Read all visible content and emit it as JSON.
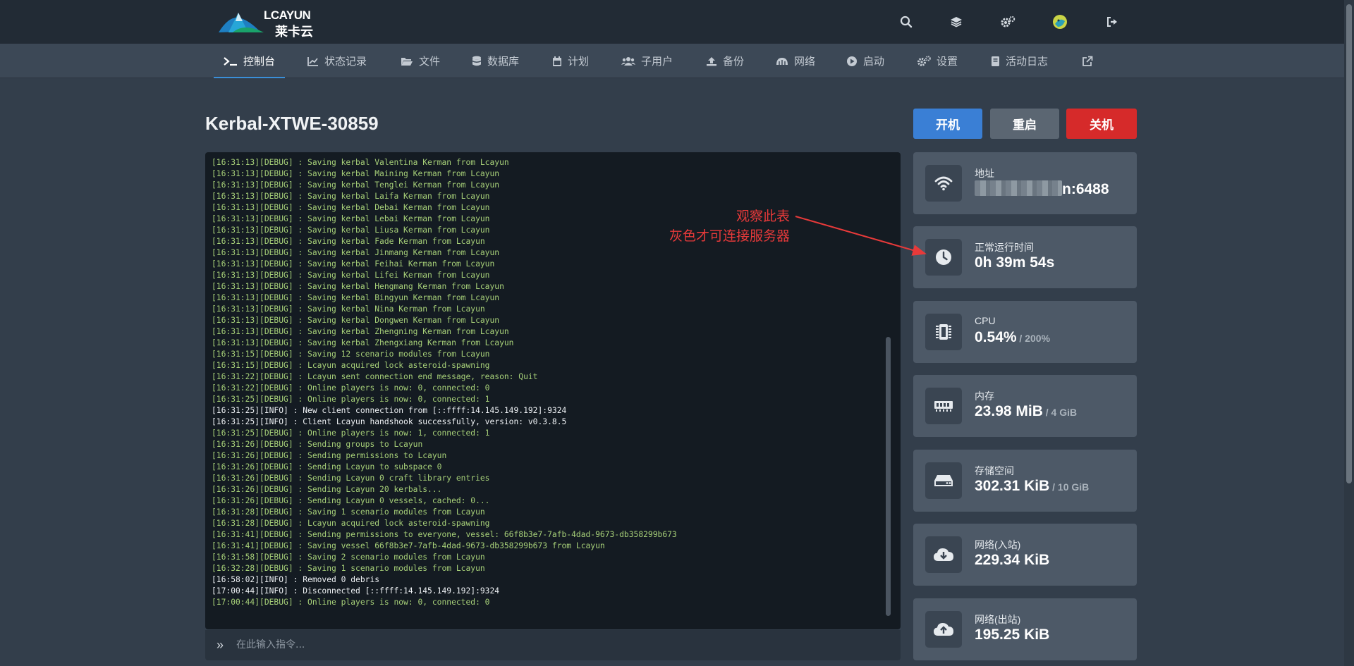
{
  "brand": {
    "logo_text": "LCAYUN",
    "logo_sub": "莱卡云"
  },
  "header_icons": [
    "search-icon",
    "layers-icon",
    "gears-icon",
    "avatar",
    "logout-icon"
  ],
  "nav": {
    "items": [
      {
        "label": "控制台",
        "icon": "terminal-icon",
        "active": true
      },
      {
        "label": "状态记录",
        "icon": "chart-icon"
      },
      {
        "label": "文件",
        "icon": "folder-icon"
      },
      {
        "label": "数据库",
        "icon": "database-icon"
      },
      {
        "label": "计划",
        "icon": "calendar-icon"
      },
      {
        "label": "子用户",
        "icon": "users-icon"
      },
      {
        "label": "备份",
        "icon": "upload-icon"
      },
      {
        "label": "网络",
        "icon": "network-icon"
      },
      {
        "label": "启动",
        "icon": "play-icon"
      },
      {
        "label": "设置",
        "icon": "settings-icon"
      },
      {
        "label": "活动日志",
        "icon": "book-icon"
      }
    ],
    "external_icon": "external-link-icon"
  },
  "server": {
    "title": "Kerbal-XTWE-30859"
  },
  "power": {
    "start": "开机",
    "restart": "重启",
    "stop": "关机"
  },
  "console": {
    "placeholder": "在此输入指令...",
    "prompt": "»",
    "lines": [
      {
        "level": "debug",
        "text": "[16:31:13][DEBUG] : Saving kerbal Valentina Kerman from Lcayun"
      },
      {
        "level": "debug",
        "text": "[16:31:13][DEBUG] : Saving kerbal Maining Kerman from Lcayun"
      },
      {
        "level": "debug",
        "text": "[16:31:13][DEBUG] : Saving kerbal Tenglei Kerman from Lcayun"
      },
      {
        "level": "debug",
        "text": "[16:31:13][DEBUG] : Saving kerbal Laifa Kerman from Lcayun"
      },
      {
        "level": "debug",
        "text": "[16:31:13][DEBUG] : Saving kerbal Debai Kerman from Lcayun"
      },
      {
        "level": "debug",
        "text": "[16:31:13][DEBUG] : Saving kerbal Lebai Kerman from Lcayun"
      },
      {
        "level": "debug",
        "text": "[16:31:13][DEBUG] : Saving kerbal Liusa Kerman from Lcayun"
      },
      {
        "level": "debug",
        "text": "[16:31:13][DEBUG] : Saving kerbal Fade Kerman from Lcayun"
      },
      {
        "level": "debug",
        "text": "[16:31:13][DEBUG] : Saving kerbal Jinmang Kerman from Lcayun"
      },
      {
        "level": "debug",
        "text": "[16:31:13][DEBUG] : Saving kerbal Feihai Kerman from Lcayun"
      },
      {
        "level": "debug",
        "text": "[16:31:13][DEBUG] : Saving kerbal Lifei Kerman from Lcayun"
      },
      {
        "level": "debug",
        "text": "[16:31:13][DEBUG] : Saving kerbal Hengmang Kerman from Lcayun"
      },
      {
        "level": "debug",
        "text": "[16:31:13][DEBUG] : Saving kerbal Bingyun Kerman from Lcayun"
      },
      {
        "level": "debug",
        "text": "[16:31:13][DEBUG] : Saving kerbal Nina Kerman from Lcayun"
      },
      {
        "level": "debug",
        "text": "[16:31:13][DEBUG] : Saving kerbal Dongwen Kerman from Lcayun"
      },
      {
        "level": "debug",
        "text": "[16:31:13][DEBUG] : Saving kerbal Zhengning Kerman from Lcayun"
      },
      {
        "level": "debug",
        "text": "[16:31:13][DEBUG] : Saving kerbal Zhengxiang Kerman from Lcayun"
      },
      {
        "level": "debug",
        "text": "[16:31:15][DEBUG] : Saving 12 scenario modules from Lcayun"
      },
      {
        "level": "debug",
        "text": "[16:31:15][DEBUG] : Lcayun acquired lock asteroid-spawning"
      },
      {
        "level": "debug",
        "text": "[16:31:22][DEBUG] : Lcayun sent connection end message, reason: Quit"
      },
      {
        "level": "debug",
        "text": "[16:31:22][DEBUG] : Online players is now: 0, connected: 0"
      },
      {
        "level": "debug",
        "text": "[16:31:25][DEBUG] : Online players is now: 0, connected: 1"
      },
      {
        "level": "info",
        "text": "[16:31:25][INFO] : New client connection from [::ffff:14.145.149.192]:9324"
      },
      {
        "level": "info",
        "text": "[16:31:25][INFO] : Client Lcayun handshook successfully, version: v0.3.8.5"
      },
      {
        "level": "debug",
        "text": "[16:31:25][DEBUG] : Online players is now: 1, connected: 1"
      },
      {
        "level": "debug",
        "text": "[16:31:26][DEBUG] : Sending groups to Lcayun"
      },
      {
        "level": "debug",
        "text": "[16:31:26][DEBUG] : Sending permissions to Lcayun"
      },
      {
        "level": "debug",
        "text": "[16:31:26][DEBUG] : Sending Lcayun to subspace 0"
      },
      {
        "level": "debug",
        "text": "[16:31:26][DEBUG] : Sending Lcayun 0 craft library entries"
      },
      {
        "level": "debug",
        "text": "[16:31:26][DEBUG] : Sending Lcayun 20 kerbals..."
      },
      {
        "level": "debug",
        "text": "[16:31:26][DEBUG] : Sending Lcayun 0 vessels, cached: 0..."
      },
      {
        "level": "debug",
        "text": "[16:31:28][DEBUG] : Saving 1 scenario modules from Lcayun"
      },
      {
        "level": "debug",
        "text": "[16:31:28][DEBUG] : Lcayun acquired lock asteroid-spawning"
      },
      {
        "level": "debug",
        "text": "[16:31:41][DEBUG] : Sending permissions to everyone, vessel: 66f8b3e7-7afb-4dad-9673-db358299b673"
      },
      {
        "level": "debug",
        "text": "[16:31:41][DEBUG] : Saving vessel 66f8b3e7-7afb-4dad-9673-db358299b673 from Lcayun"
      },
      {
        "level": "debug",
        "text": "[16:31:58][DEBUG] : Saving 2 scenario modules from Lcayun"
      },
      {
        "level": "debug",
        "text": "[16:32:28][DEBUG] : Saving 1 scenario modules from Lcayun"
      },
      {
        "level": "info",
        "text": "[16:58:02][INFO] : Removed 0 debris"
      },
      {
        "level": "info",
        "text": "[17:00:44][INFO] : Disconnected [::ffff:14.145.149.192]:9324"
      },
      {
        "level": "debug",
        "text": "[17:00:44][DEBUG] : Online players is now: 0, connected: 0"
      }
    ]
  },
  "stats": [
    {
      "name": "address",
      "icon": "wifi-icon",
      "label": "地址",
      "value": "n:6488",
      "sub": "",
      "masked": true
    },
    {
      "name": "uptime",
      "icon": "clock-icon",
      "label": "正常运行时间",
      "value": "0h 39m 54s",
      "sub": ""
    },
    {
      "name": "cpu",
      "icon": "cpu-icon",
      "label": "CPU",
      "value": "0.54%",
      "sub": " / 200%"
    },
    {
      "name": "memory",
      "icon": "memory-icon",
      "label": "内存",
      "value": "23.98 MiB",
      "sub": " / 4 GiB"
    },
    {
      "name": "storage",
      "icon": "drive-icon",
      "label": "存储空间",
      "value": "302.31 KiB",
      "sub": " / 10 GiB"
    },
    {
      "name": "network-in",
      "icon": "cloud-download-icon",
      "label": "网络(入站)",
      "value": "229.34 KiB",
      "sub": ""
    },
    {
      "name": "network-out",
      "icon": "cloud-upload-icon",
      "label": "网络(出站)",
      "value": "195.25 KiB",
      "sub": ""
    }
  ],
  "annotation": {
    "line1": "观察此表",
    "line2": "灰色才可连接服务器",
    "color": "#e83a3a"
  },
  "colors": {
    "accent": "#3a7fd5",
    "danger": "#d62a2a",
    "debug_text": "#a6cf78"
  }
}
